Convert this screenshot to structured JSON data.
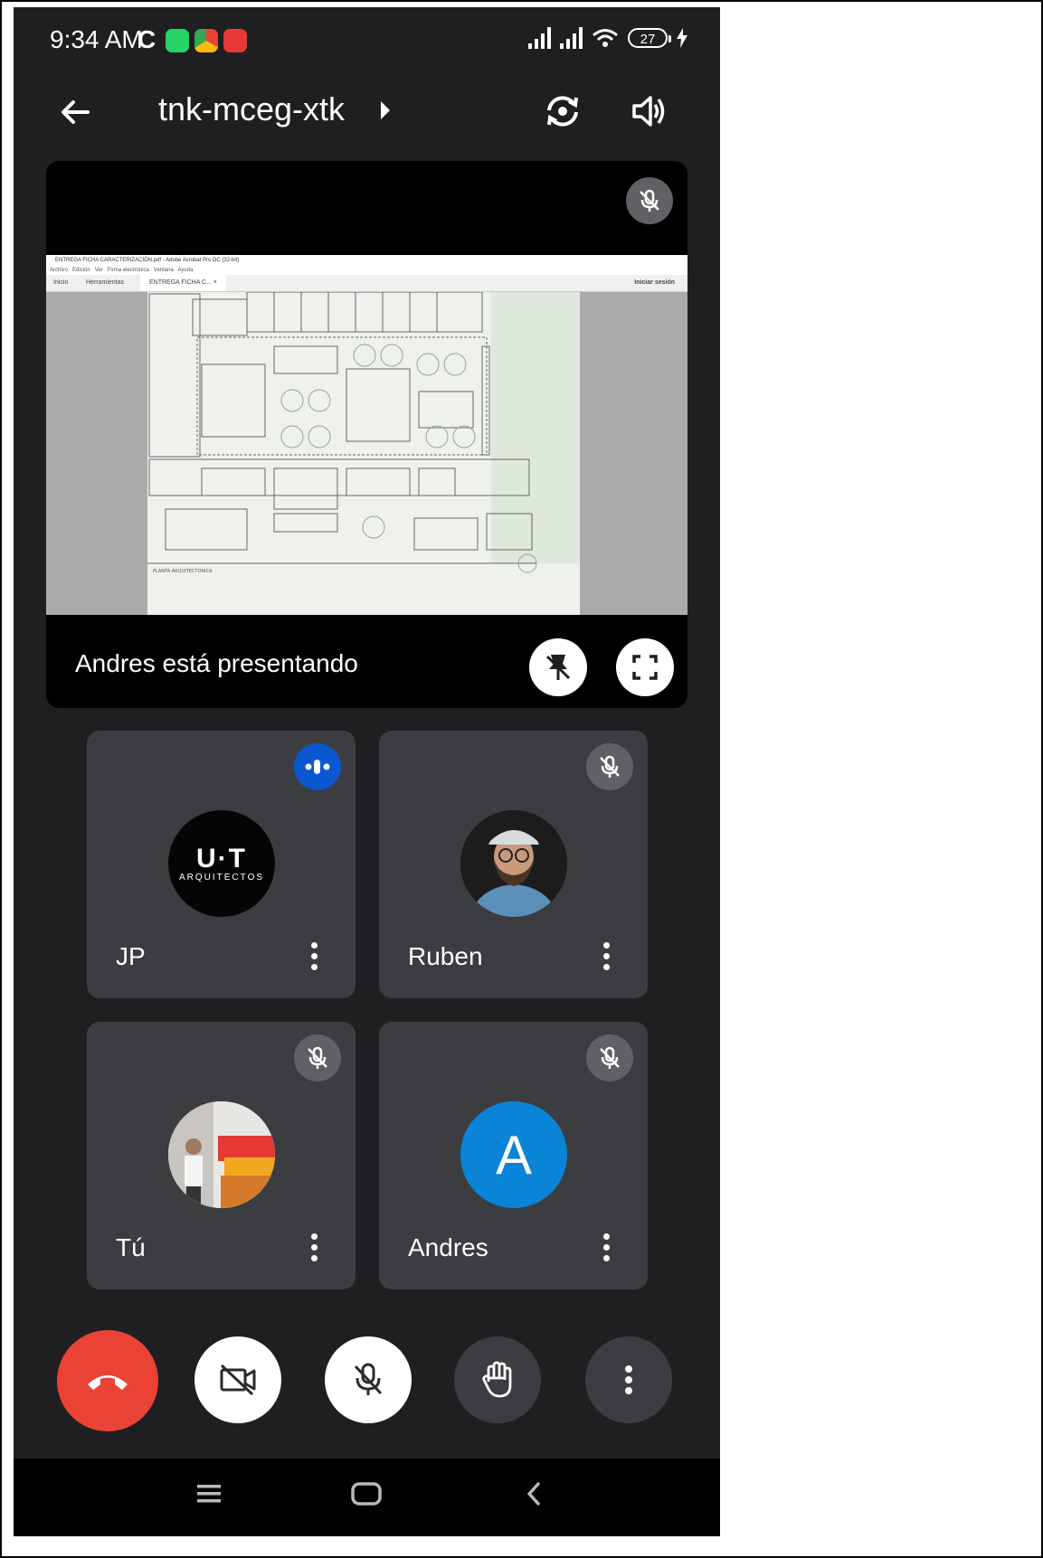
{
  "status_bar": {
    "time": "9:34 AM",
    "indicator": "C",
    "battery": "27"
  },
  "header": {
    "meeting_code": "tnk-mceg-xtk"
  },
  "presentation": {
    "presenter_text": "Andres está presentando",
    "screen": {
      "window_title": "ENTREGA FICHA CARACTERIZACIÓN.pdf - Adobe Acrobat Pro DC (32-bit)",
      "menu": [
        "Archivo",
        "Edición",
        "Ver",
        "Firma electrónica",
        "Ventana",
        "Ayuda"
      ],
      "tabs": [
        "Inicio",
        "Herramientas",
        "ENTREGA FICHA C... ×"
      ],
      "sign_in": "Iniciar sesión"
    }
  },
  "participants": [
    {
      "name": "JP",
      "status": "speaking",
      "avatar_text": "U·T",
      "avatar_subtext": "ARQUITECTOS"
    },
    {
      "name": "Ruben",
      "status": "muted"
    },
    {
      "name": "Tú",
      "status": "muted"
    },
    {
      "name": "Andres",
      "status": "muted",
      "avatar_letter": "A"
    }
  ],
  "colors": {
    "background": "#1f1f22",
    "tile": "#3c3d41",
    "hangup": "#ea4335",
    "speaking": "#0b57d0",
    "avatar_andres": "#0a84d6"
  }
}
